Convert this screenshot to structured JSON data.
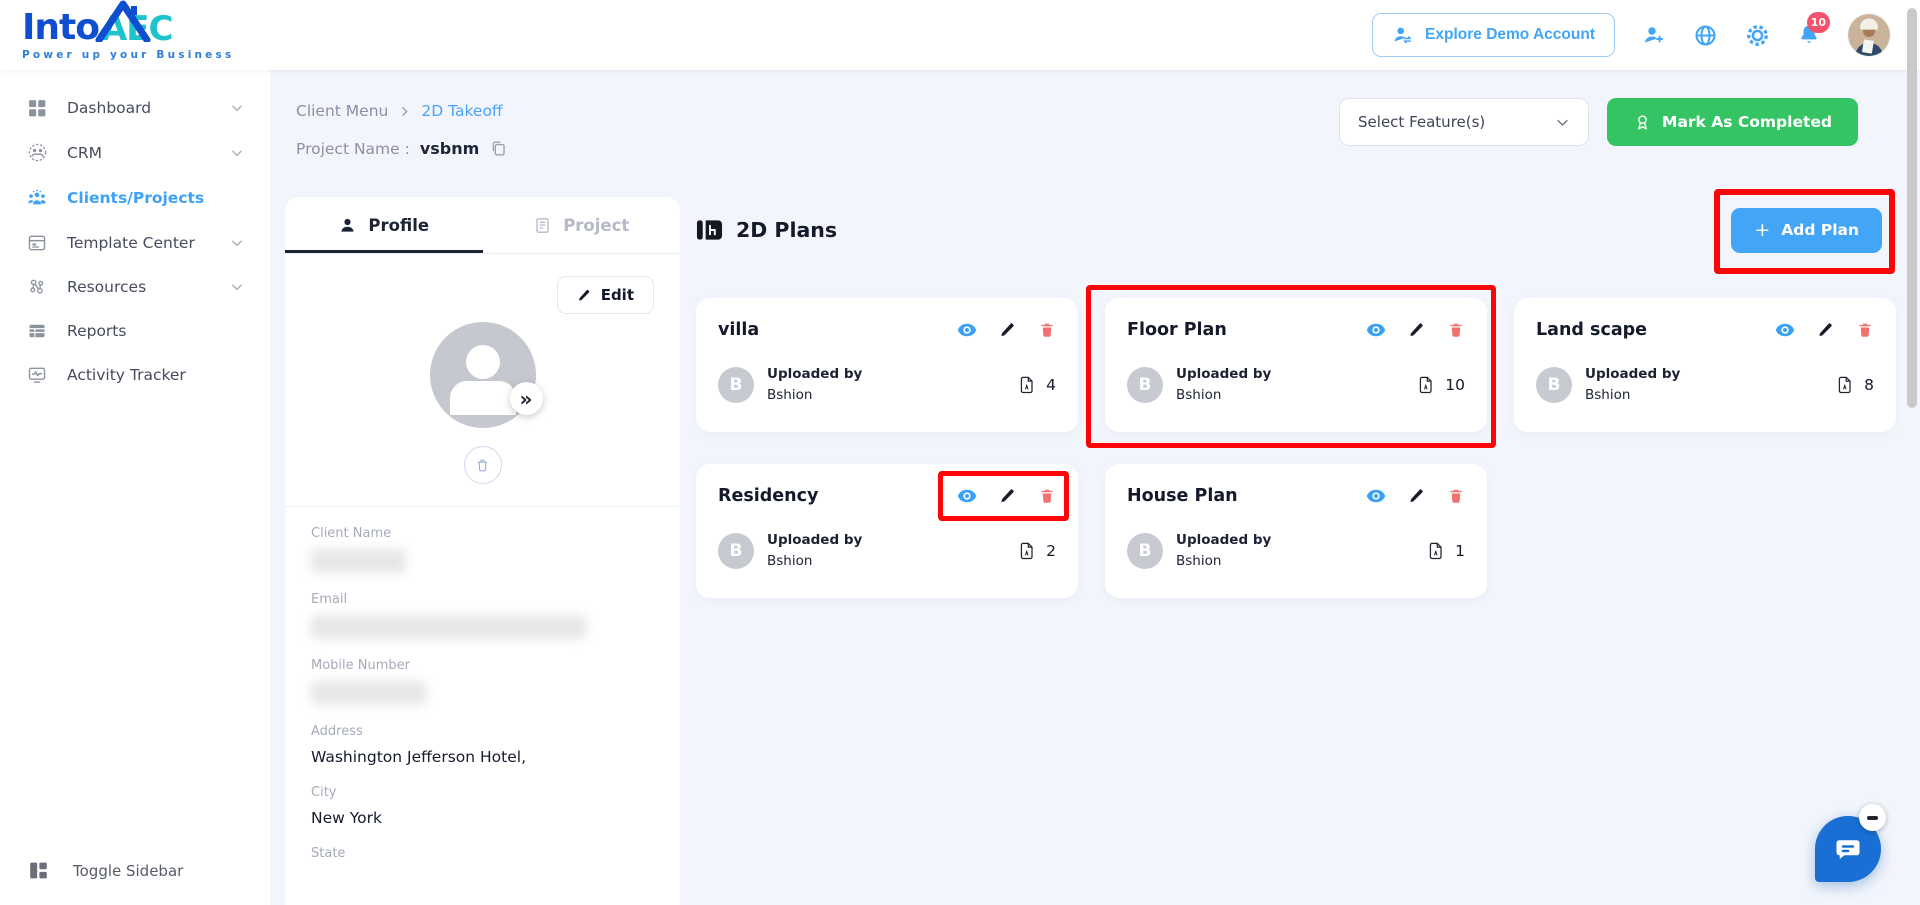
{
  "header": {
    "logo": {
      "into": "Into",
      "aec": "AEC",
      "tagline": "Power up your Business"
    },
    "explore_demo_label": "Explore Demo Account",
    "notification_count": "10"
  },
  "sidebar": {
    "items": [
      {
        "label": "Dashboard",
        "has_chevron": true,
        "active": false
      },
      {
        "label": "CRM",
        "has_chevron": true,
        "active": false
      },
      {
        "label": "Clients/Projects",
        "has_chevron": false,
        "active": true
      },
      {
        "label": "Template Center",
        "has_chevron": true,
        "active": false
      },
      {
        "label": "Resources",
        "has_chevron": true,
        "active": false
      },
      {
        "label": "Reports",
        "has_chevron": false,
        "active": false
      },
      {
        "label": "Activity Tracker",
        "has_chevron": false,
        "active": false
      }
    ],
    "toggle_label": "Toggle Sidebar"
  },
  "breadcrumb": {
    "parent": "Client Menu",
    "current": "2D Takeoff",
    "project_label": "Project Name :",
    "project_name": "vsbnm"
  },
  "toolbar": {
    "select_features_label": "Select Feature(s)",
    "mark_completed_label": "Mark As Completed"
  },
  "profile_panel": {
    "tabs": [
      {
        "label": "Profile"
      },
      {
        "label": "Project"
      }
    ],
    "edit_label": "Edit",
    "avatar_expand_glyph": "»",
    "fields": [
      {
        "label": "Client Name",
        "value": ""
      },
      {
        "label": "Email",
        "value": ""
      },
      {
        "label": "Mobile Number",
        "value": ""
      },
      {
        "label": "Address",
        "value": "Washington Jefferson Hotel,"
      },
      {
        "label": "City",
        "value": "New York"
      },
      {
        "label": "State",
        "value": ""
      }
    ]
  },
  "plans": {
    "title": "2D Plans",
    "add_plus": "+",
    "add_label": "Add Plan",
    "uploaded_by_label": "Uploaded by",
    "cards": [
      {
        "name": "villa",
        "uploader": "Bshion",
        "initial": "B",
        "count": "4"
      },
      {
        "name": "Floor Plan",
        "uploader": "Bshion",
        "initial": "B",
        "count": "10"
      },
      {
        "name": "Land scape",
        "uploader": "Bshion",
        "initial": "B",
        "count": "8"
      },
      {
        "name": "Residency",
        "uploader": "Bshion",
        "initial": "B",
        "count": "2"
      },
      {
        "name": "House Plan",
        "uploader": "Bshion",
        "initial": "B",
        "count": "1"
      }
    ]
  },
  "colors": {
    "accent_blue": "#42a5f5",
    "active_link_blue": "#3da1f8",
    "breadcrumb_blue": "#4da3f7",
    "green_button": "#35c463",
    "delete_red": "#f0716d",
    "badge_red": "#f4516c",
    "annotation_red": "#fb0606",
    "logo_blue": "#0d4fd0",
    "logo_teal": "#1fc3ce",
    "content_bg": "#f2f6fc"
  }
}
